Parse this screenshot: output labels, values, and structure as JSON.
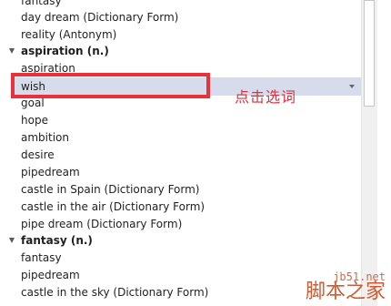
{
  "list": {
    "rows_top": [
      {
        "text": "fantasy"
      },
      {
        "text": "day dream (Dictionary Form)"
      },
      {
        "text": "reality (Antonym)"
      }
    ],
    "header_aspiration": "aspiration (n.)",
    "aspiration_first": "aspiration",
    "selected_item": "wish",
    "aspiration_items": [
      "goal",
      "hope",
      "ambition",
      "desire",
      "pipedream",
      "castle in Spain (Dictionary Form)",
      "castle in the air (Dictionary Form)",
      "pipe dream (Dictionary Form)"
    ],
    "header_fantasy": "fantasy (n.)",
    "fantasy_items": [
      "fantasy",
      "pipedream",
      "castle in the sky (Dictionary Form)"
    ]
  },
  "annotation": {
    "text": "点击选词",
    "color": "#e0303c"
  },
  "highlight_color": "#e8313a",
  "selection_color": "#d7dcec",
  "watermark": {
    "url": "jb51.net",
    "name": "脚本之家"
  }
}
